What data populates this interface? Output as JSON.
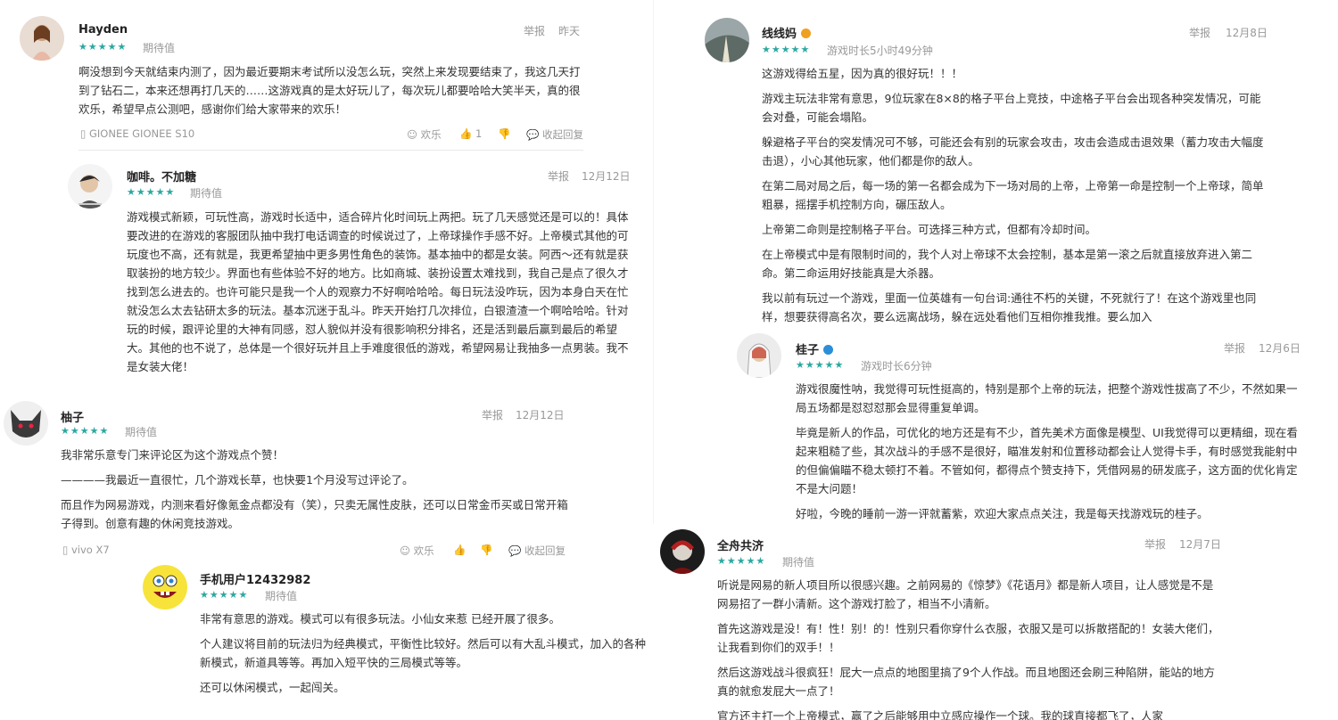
{
  "reviews": {
    "hayden": {
      "name": "Hayden",
      "stars": "★★★★★",
      "tag": "期待值",
      "report": "举报",
      "date": "昨天",
      "body": "啊没想到今天就结束内测了，因为最近要期末考试所以没怎么玩，突然上来发现要结束了，我这几天打到了钻石二，本来还想再打几天的……这游戏真的是太好玩儿了，每次玩儿都要哈哈大笑半天，真的很欢乐，希望早点公测吧，感谢你们给大家带来的欢乐！",
      "device": "GIONEE GIONEE S10",
      "joy": "欢乐",
      "likes": "1",
      "fold": "收起回复"
    },
    "kafei": {
      "name": "咖啡。不加糖",
      "stars": "★★★★★",
      "tag": "期待值",
      "report": "举报",
      "date": "12月12日",
      "body": "游戏模式新颖，可玩性高，游戏时长适中，适合碎片化时间玩上两把。玩了几天感觉还是可以的！具体要改进的在游戏的客服团队抽中我打电话调查的时候说过了，上帝球操作手感不好。上帝模式其他的可玩度也不高，还有就是，我更希望抽中更多男性角色的装饰。基本抽中的都是女装。阿西～还有就是获取装扮的地方较少。界面也有些体验不好的地方。比如商城、装扮设置太难找到，我自己是点了很久才找到怎么进去的。也许可能只是我一个人的观察力不好啊哈哈哈。每日玩法没咋玩，因为本身白天在忙就没怎么太去钻研太多的玩法。基本沉迷于乱斗。昨天开始打几次排位，白银渣渣一个啊哈哈哈。针对玩的时候，跟评论里的大神有同感，怼人貌似并没有很影响积分排名，还是活到最后赢到最后的希望大。其他的也不说了，总体是一个很好玩并且上手难度很低的游戏，希望网易让我抽多一点男装。我不是女装大佬！"
    },
    "youzi": {
      "name": "柚子",
      "stars": "★★★★★",
      "tag": "期待值",
      "report": "举报",
      "date": "12月12日",
      "paragraphs": [
        "我非常乐意专门来评论区为这个游戏点个赞！",
        "————我最近一直很忙，几个游戏长草，也快要1个月没写过评论了。",
        "而且作为网易游戏，内测来看好像氪金点都没有（笑），只卖无属性皮肤，还可以日常金币买或日常开箱子得到。创意有趣的休闲竞技游戏。"
      ],
      "device": "vivo X7",
      "joy": "欢乐",
      "fold": "收起回复"
    },
    "phone_user": {
      "name": "手机用户12432982",
      "stars": "★★★★★",
      "tag": "期待值",
      "paragraphs": [
        "非常有意思的游戏。模式可以有很多玩法。小仙女来惹 已经开展了很多。",
        "个人建议将目前的玩法归为经典模式，平衡性比较好。然后可以有大乱斗模式，加入的各种新模式，新道具等等。再加入短平快的三局模式等等。",
        "还可以休闲模式，一起闯关。"
      ]
    },
    "xianxianma": {
      "name": "线线妈",
      "stars": "★★★★★",
      "tag": "游戏时长5小时49分钟",
      "report": "举报",
      "date": "12月8日",
      "paragraphs": [
        "这游戏得给五星，因为真的很好玩！！！",
        "游戏主玩法非常有意思，9位玩家在8×8的格子平台上竞技，中途格子平台会出现各种突发情况，可能会对叠，可能会塌陷。",
        "躲避格子平台的突发情况可不够，可能还会有别的玩家会攻击，攻击会造成击退效果（蓄力攻击大幅度击退），小心其他玩家，他们都是你的敌人。",
        "在第二局对局之后，每一场的第一名都会成为下一场对局的上帝，上帝第一命是控制一个上帝球，简单粗暴，摇摆手机控制方向，碾压敌人。",
        "上帝第二命则是控制格子平台。可选择三种方式，但都有冷却时间。",
        "在上帝模式中是有限制时间的，我个人对上帝球不太会控制，基本是第一滚之后就直接放弃进入第二命。第二命运用好技能真是大杀器。",
        "我以前有玩过一个游戏，里面一位英雄有一句台词:通往不朽的关键，不死就行了！在这个游戏里也同样，想要获得高名次，要么远离战场，躲在远处看他们互相你推我推。要么加入"
      ]
    },
    "guizi": {
      "name": "桂子",
      "stars": "★★★★★",
      "tag": "游戏时长6分钟",
      "report": "举报",
      "date": "12月6日",
      "paragraphs": [
        "游戏很魔性呐，我觉得可玩性挺高的，特别是那个上帝的玩法，把整个游戏性拔高了不少，不然如果一局五场都是怼怼怼那会显得重复单调。",
        "毕竟是新人的作品，可优化的地方还是有不少，首先美术方面像是模型、UI我觉得可以更精细，现在看起来粗糙了些，其次战斗的手感不是很好，瞄准发射和位置移动都会让人觉得卡手，有时感觉我能射中的但偏偏瞄不稳太顿打不着。不管如何，都得点个赞支持下，凭借网易的研发底子，这方面的优化肯定不是大问题！",
        "好啦，今晚的睡前一游一评就蓄紫，欢迎大家点点关注，我是每天找游戏玩的桂子。"
      ]
    },
    "quanzhou": {
      "name": "全舟共济",
      "stars": "★★★★★",
      "tag": "期待值",
      "report": "举报",
      "date": "12月7日",
      "paragraphs": [
        "听说是网易的新人项目所以很感兴趣。之前网易的《惊梦》《花语月》都是新人项目，让人感觉是不是网易招了一群小清新。这个游戏打脸了，相当不小清新。",
        "首先这游戏是没！有！性！别！的！性别只看你穿什么衣服，衣服又是可以拆散搭配的！女装大佬们，让我看到你们的双手！！",
        "然后这游戏战斗很疯狂！屁大一点点的地图里搞了9个人作战。而且地图还会刷三种陷阱，能站的地方真的就愈发屁大一点了！",
        "官方还主打一个上帝模式，赢了之后能够用中立感应操作一个球。我的球直接都飞了，人家"
      ]
    }
  },
  "colors": {
    "star": "#2ca8a0",
    "gold_badge": "#f0a020",
    "verified": "#2b8ed8"
  }
}
